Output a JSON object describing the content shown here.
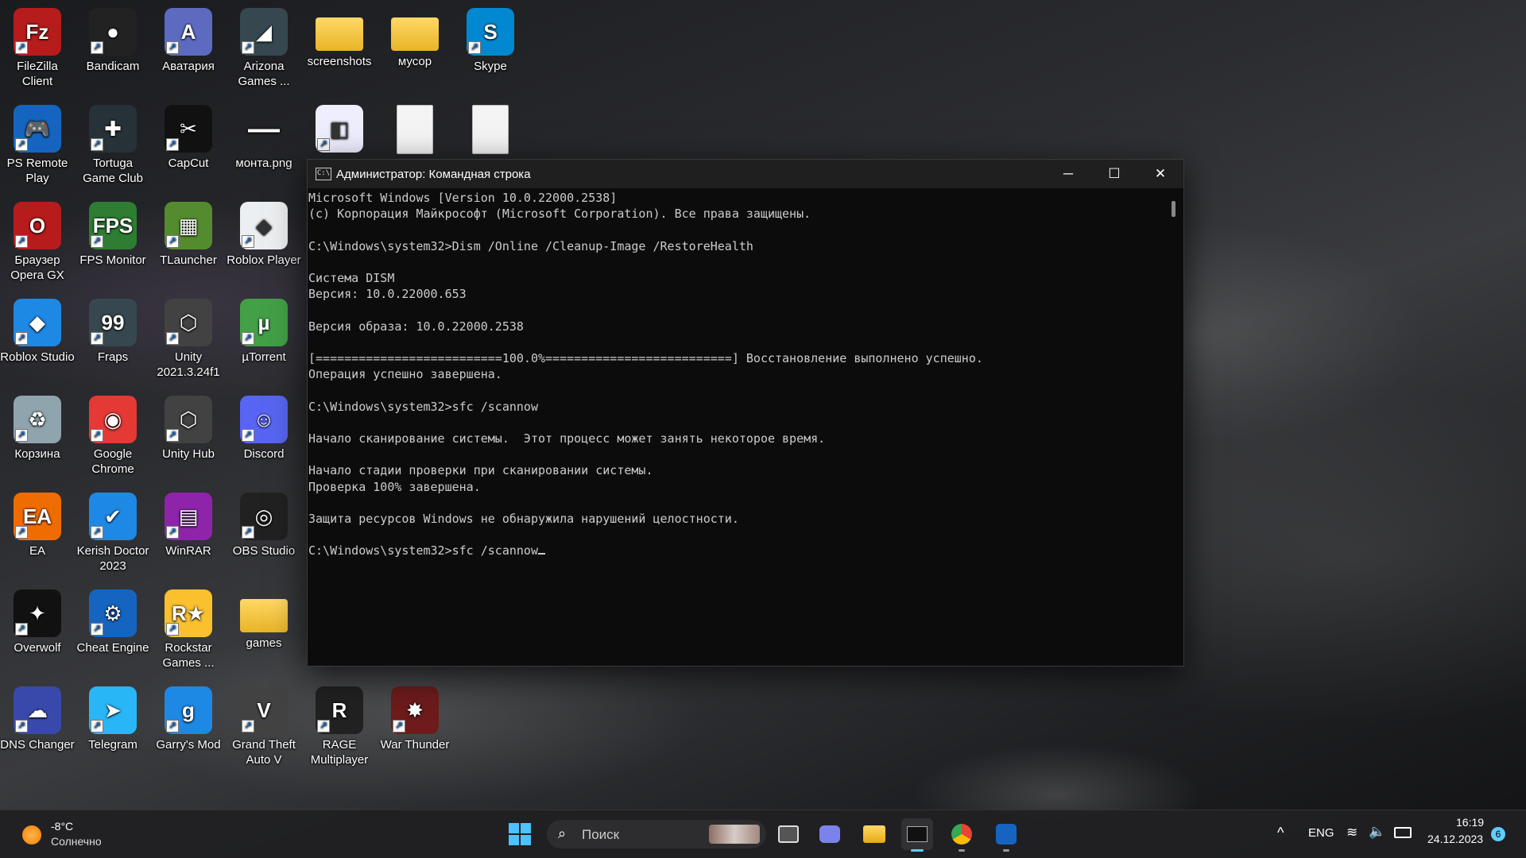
{
  "desktop": {
    "icons": [
      {
        "label": "FileZilla Client",
        "glyph": "Fz",
        "color": "#b71c1c"
      },
      {
        "label": "Bandicam",
        "glyph": "●",
        "color": "#222"
      },
      {
        "label": "Аватария",
        "glyph": "A",
        "color": "#5c6bc0"
      },
      {
        "label": "Arizona Games ...",
        "glyph": "◢",
        "color": "#37474f"
      },
      {
        "label": "screenshots",
        "glyph": "",
        "color": "folder"
      },
      {
        "label": "мусор",
        "glyph": "",
        "color": "folder"
      },
      {
        "label": "Skype",
        "glyph": "S",
        "color": "#0288d1"
      },
      {
        "label": "PS Remote Play",
        "glyph": "🎮",
        "color": "#1565c0"
      },
      {
        "label": "Tortuga Game Club",
        "glyph": "✚",
        "color": "#263238"
      },
      {
        "label": "CapCut",
        "glyph": "✂",
        "color": "#111"
      },
      {
        "label": "монта.png",
        "glyph": "—",
        "color": "transparent"
      },
      {
        "label": "",
        "glyph": "◧",
        "color": "#eef"
      },
      {
        "label": "",
        "glyph": "",
        "color": "file"
      },
      {
        "label": "",
        "glyph": "",
        "color": "file"
      },
      {
        "label": "Браузер Opera GX",
        "glyph": "O",
        "color": "#b71c1c"
      },
      {
        "label": "FPS Monitor",
        "glyph": "FPS",
        "color": "#2e7d32"
      },
      {
        "label": "TLauncher",
        "glyph": "▦",
        "color": "#558b2f"
      },
      {
        "label": "Roblox Player",
        "glyph": "◆",
        "color": "#eceff1"
      },
      {
        "label": "Roblox Studio",
        "glyph": "◆",
        "color": "#1e88e5"
      },
      {
        "label": "Fraps",
        "glyph": "99",
        "color": "#37474f"
      },
      {
        "label": "Unity 2021.3.24f1",
        "glyph": "⬡",
        "color": "#424242"
      },
      {
        "label": "µTorrent",
        "glyph": "µ",
        "color": "#43a047"
      },
      {
        "label": "Корзина",
        "glyph": "♻",
        "color": "#90a4ae"
      },
      {
        "label": "Google Chrome",
        "glyph": "◉",
        "color": "#e53935"
      },
      {
        "label": "Unity Hub",
        "glyph": "⬡",
        "color": "#424242"
      },
      {
        "label": "Discord",
        "glyph": "☺",
        "color": "#5865f2"
      },
      {
        "label": "EA",
        "glyph": "EA",
        "color": "#ef6c00"
      },
      {
        "label": "Kerish Doctor 2023",
        "glyph": "✔",
        "color": "#1e88e5"
      },
      {
        "label": "WinRAR",
        "glyph": "▤",
        "color": "#8e24aa"
      },
      {
        "label": "OBS Studio",
        "glyph": "◎",
        "color": "#212121"
      },
      {
        "label": "Overwolf",
        "glyph": "✦",
        "color": "#111"
      },
      {
        "label": "Cheat Engine",
        "glyph": "⚙",
        "color": "#1565c0"
      },
      {
        "label": "Rockstar Games ...",
        "glyph": "R★",
        "color": "#fbc02d"
      },
      {
        "label": "games",
        "glyph": "",
        "color": "folder"
      },
      {
        "label": "DNS Changer",
        "glyph": "☁",
        "color": "#3949ab"
      },
      {
        "label": "Telegram",
        "glyph": "➤",
        "color": "#29b6f6"
      },
      {
        "label": "Garry's Mod",
        "glyph": "g",
        "color": "#1e88e5"
      },
      {
        "label": "Grand Theft Auto V",
        "glyph": "V",
        "color": "#424242"
      },
      {
        "label": "RAGE Multiplayer",
        "glyph": "R",
        "color": "#212121"
      },
      {
        "label": "War Thunder",
        "glyph": "✸",
        "color": "#6d1b1b"
      }
    ]
  },
  "terminal": {
    "title": "Администратор: Командная строка",
    "title_icon": "C:\\",
    "minimize": "─",
    "maximize": "☐",
    "close": "✕",
    "lines": [
      "Microsoft Windows [Version 10.0.22000.2538]",
      "(c) Корпорация Майкрософт (Microsoft Corporation). Все права защищены.",
      "",
      "C:\\Windows\\system32>Dism /Online /Cleanup-Image /RestoreHealth",
      "",
      "Система DISM",
      "Версия: 10.0.22000.653",
      "",
      "Версия образа: 10.0.22000.2538",
      "",
      "[==========================100.0%==========================] Восстановление выполнено успешно.",
      "Операция успешно завершена.",
      "",
      "C:\\Windows\\system32>sfc /scannow",
      "",
      "Начало сканирование системы.  Этот процесс может занять некоторое время.",
      "",
      "Начало стадии проверки при сканировании системы.",
      "Проверка 100% завершена.",
      "",
      "Защита ресурсов Windows не обнаружила нарушений целостности.",
      ""
    ],
    "prompt_line": "C:\\Windows\\system32>sfc /scannow"
  },
  "taskbar": {
    "weather_temp": "-8°C",
    "weather_desc": "Солнечно",
    "search_placeholder": "Поиск",
    "lang": "ENG",
    "time": "16:19",
    "date": "24.12.2023",
    "notification_count": "6",
    "tray_chevron": "^"
  }
}
